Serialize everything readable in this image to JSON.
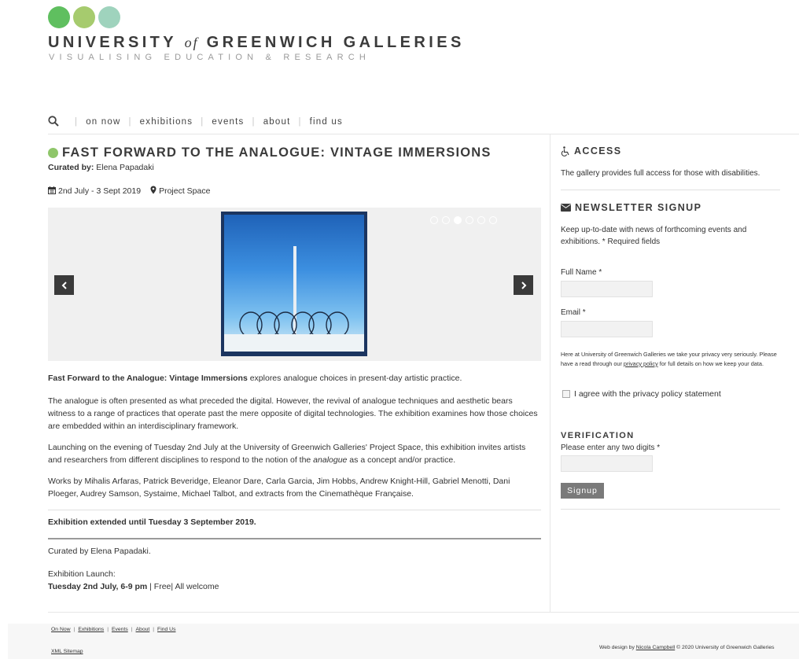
{
  "logo": {
    "title_part1": "UNIVERSITY",
    "title_of": "of",
    "title_part2": "GREENWICH GALLERIES",
    "subtitle": "VISUALISING EDUCATION & RESEARCH"
  },
  "nav": {
    "items": [
      "on now",
      "exhibitions",
      "events",
      "about",
      "find us"
    ]
  },
  "exhibition": {
    "title": "FAST FORWARD TO THE ANALOGUE: VINTAGE IMMERSIONS",
    "curated_label": "Curated by:",
    "curator": "Elena Papadaki",
    "dates": "2nd July - 3 Sept 2019",
    "venue": "Project Space",
    "slider": {
      "slide_count": 6,
      "active_index": 2
    },
    "intro_bold": "Fast Forward to the Analogue: Vintage Immersions",
    "intro_rest": " explores analogue choices in present-day artistic practice.",
    "para2": "The analogue is often presented as what preceded the digital. However, the revival of analogue techniques and aesthetic bears witness to a range of practices that operate past the mere opposite of digital technologies. The exhibition examines how those choices are embedded within an interdisciplinary framework.",
    "para3_before": "Launching on the evening of Tuesday 2nd July at the University of Greenwich Galleries' Project Space, this exhibition invites artists and researchers from different disciplines to respond to the notion of the ",
    "para3_italic": "analogue",
    "para3_after": " as a concept and/or practice.",
    "para4": "Works by Mihalis Arfaras, Patrick Beveridge, Eleanor Dare, Carla Garcia, Jim Hobbs, Andrew Knight-Hill, Gabriel Menotti, Dani Ploeger, Audrey Samson, Systaime, Michael Talbot, and extracts from the Cinemathèque Française.",
    "extended": "Exhibition extended until Tuesday 3 September 2019.",
    "curated_line": "Curated by Elena Papadaki.",
    "launch_label": "Exhibition Launch:",
    "launch_when": "Tuesday 2nd July, 6-9 pm",
    "launch_rest": " | Free| All welcome"
  },
  "sidebar": {
    "access_title": "ACCESS",
    "access_text": "The gallery provides full access for those with disabilities.",
    "newsletter_title": "NEWSLETTER SIGNUP",
    "newsletter_text": "Keep up-to-date with news of forthcoming events and exhibitions. * Required fields",
    "full_name_label": "Full Name *",
    "email_label": "Email *",
    "privacy_before": "Here at University of Greenwich Galleries we take your privacy very seriously. Please have a read through our ",
    "privacy_link": "privacy policy",
    "privacy_after": " for full details on how we keep your data.",
    "agree_label": "I agree with the privacy policy statement",
    "verification_title": "VERIFICATION",
    "verification_text": "Please enter any two digits *",
    "signup_button": "Signup"
  },
  "footer": {
    "links": [
      "On Now",
      "Exhibitions",
      "Events",
      "About",
      "Find Us"
    ],
    "sitemap": "XML Sitemap",
    "credit_before": "Web design by ",
    "credit_name": "Nicola Campbell",
    "credit_after": " © 2020 University of Greenwich Galleries"
  },
  "colors": {
    "dot1": "#5fbf5f",
    "dot2": "#a6cb6e",
    "dot3": "#9fd3bd",
    "title_bullet": "#8fc66a",
    "button_bg": "#7a7a7a"
  },
  "icons": {
    "search": "search-icon",
    "calendar": "calendar-icon",
    "location": "map-marker-icon",
    "access": "wheelchair-icon",
    "newsletter": "envelope-icon",
    "prev": "chevron-left-icon",
    "next": "chevron-right-icon"
  }
}
